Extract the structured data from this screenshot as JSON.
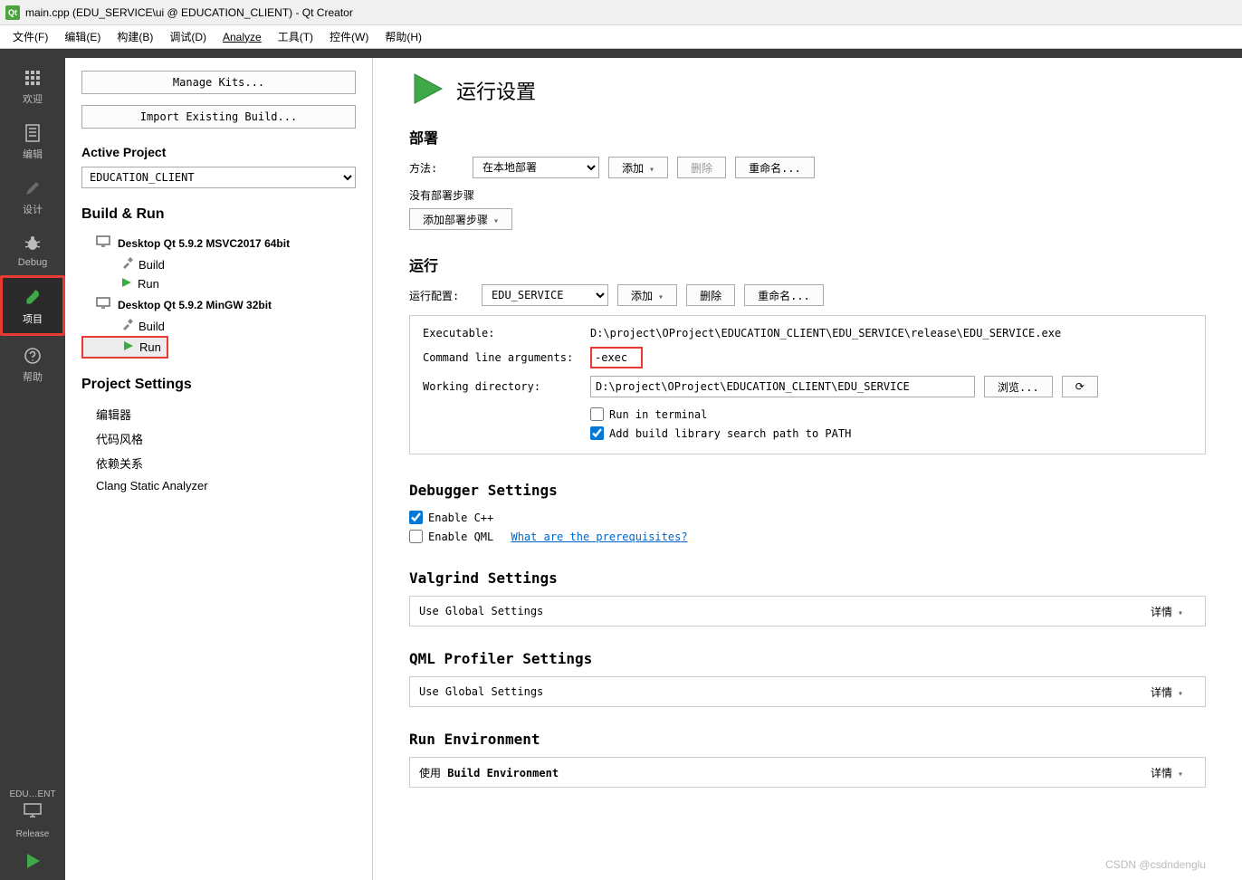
{
  "titlebar": {
    "app_icon_text": "Qt",
    "title": "main.cpp (EDU_SERVICE\\ui @ EDUCATION_CLIENT) - Qt Creator"
  },
  "menus": {
    "file": "文件(F)",
    "edit": "编辑(E)",
    "build": "构建(B)",
    "debug": "调试(D)",
    "analyze": "Analyze",
    "tools": "工具(T)",
    "widgets": "控件(W)",
    "help": "帮助(H)"
  },
  "rail": {
    "welcome": "欢迎",
    "editor": "编辑",
    "design": "设计",
    "debug": "Debug",
    "project": "项目",
    "help": "帮助",
    "bottom_config": "EDU…ENT",
    "bottom_release": "Release"
  },
  "panel": {
    "manage_kits": "Manage Kits...",
    "import_build": "Import Existing Build...",
    "active_project_h": "Active Project",
    "active_project_value": "EDUCATION_CLIENT",
    "build_run_h": "Build & Run",
    "kits": [
      {
        "name": "Desktop Qt 5.9.2 MSVC2017 64bit",
        "items": [
          "Build",
          "Run"
        ]
      },
      {
        "name": "Desktop Qt 5.9.2 MinGW 32bit",
        "items": [
          "Build",
          "Run"
        ]
      }
    ],
    "project_settings_h": "Project Settings",
    "ps_items": [
      "编辑器",
      "代码风格",
      "依赖关系",
      "Clang Static Analyzer"
    ]
  },
  "main": {
    "page_title": "运行设置",
    "deploy_h": "部署",
    "method_lbl": "方法:",
    "method_value": "在本地部署",
    "add_btn": "添加",
    "delete_btn": "删除",
    "rename_btn": "重命名...",
    "no_deploy_steps": "没有部署步骤",
    "add_deploy_step": "添加部署步骤",
    "run_h": "运行",
    "run_config_lbl": "运行配置:",
    "run_config_value": "EDU_SERVICE",
    "exe_lbl": "Executable:",
    "exe_val": "D:\\project\\OProject\\EDUCATION_CLIENT\\EDU_SERVICE\\release\\EDU_SERVICE.exe",
    "args_lbl": "Command line arguments:",
    "args_val": "-exec",
    "workdir_lbl": "Working directory:",
    "workdir_val": "D:\\project\\OProject\\EDUCATION_CLIENT\\EDU_SERVICE",
    "browse_btn": "浏览...",
    "cb_terminal": "Run in terminal",
    "cb_path": "Add build library search path to PATH",
    "debugger_h": "Debugger Settings",
    "cb_enable_cpp": "Enable C++",
    "cb_enable_qml": "Enable QML",
    "qml_link": "What are the prerequisites?",
    "valgrind_h": "Valgrind Settings",
    "global_settings": "Use Global Settings",
    "details_btn": "详情",
    "qmlprof_h": "QML Profiler Settings",
    "runenv_h": "Run Environment",
    "runenv_text_prefix": "使用 ",
    "runenv_text_bold": "Build Environment"
  },
  "watermark": "CSDN @csdndenglu"
}
